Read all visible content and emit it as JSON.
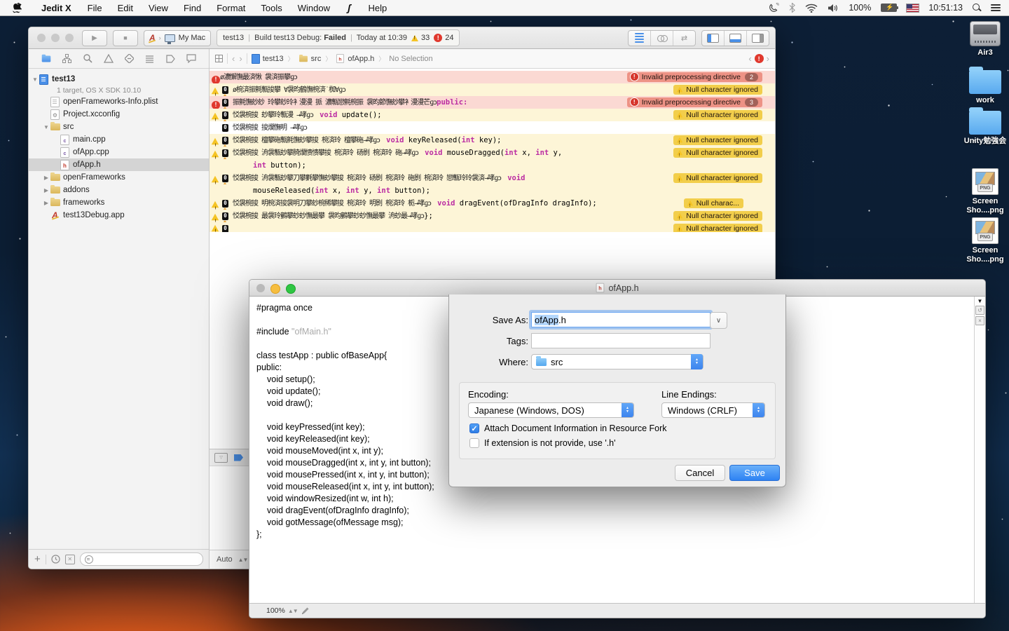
{
  "colors": {
    "accent_blue": "#3e96f5",
    "keyword_pink": "#bb2ca2",
    "warn_row_bg": "#fdf5d7",
    "warn_badge_bg": "#f2ce4b",
    "err_row_bg": "#fbd9d3",
    "err_badge_bg": "#ed9285",
    "selection_blue": "#b4d7fd"
  },
  "menu_bar": {
    "app_name": "Jedit X",
    "items": [
      "File",
      "Edit",
      "View",
      "Find",
      "Format",
      "Tools",
      "Window"
    ],
    "help": "Help",
    "script_menu_icon": "script-menu",
    "status_icons": [
      "phone-icon",
      "bluetooth-icon",
      "wifi-icon",
      "volume-icon",
      "battery-icon",
      "input-flag-us",
      "spotlight-icon",
      "notification-center-icon"
    ],
    "battery": "100%",
    "time": "10:51:13"
  },
  "desktop": {
    "icons": [
      {
        "label": "Air3",
        "kind": "drive"
      },
      {
        "label": "work",
        "kind": "folder"
      },
      {
        "label": "Unity勉強会",
        "kind": "folder"
      },
      {
        "label": "Screen Sho....png",
        "kind": "png"
      },
      {
        "label": "Screen Sho....png",
        "kind": "png"
      }
    ]
  },
  "xcode": {
    "toolbar": {
      "scheme_app": "A",
      "scheme_target": "My Mac",
      "status": {
        "project": "test13",
        "sep": "|",
        "build": "Build test13 Debug:",
        "result": "Failed",
        "time": "Today at 10:39",
        "warnings": "33",
        "errors": "24"
      }
    },
    "jump_bar": {
      "project": "test13",
      "folder": "src",
      "file": "ofApp.h",
      "selection": "No Selection"
    },
    "navigator": {
      "project": {
        "name": "test13",
        "detail": "1 target, OS X SDK 10.10"
      },
      "items": [
        {
          "label": "openFrameworks-Info.plist",
          "icon": "plist",
          "indent": 1
        },
        {
          "label": "Project.xcconfig",
          "icon": "xcconfig",
          "indent": 1
        },
        {
          "label": "src",
          "icon": "folder",
          "indent": 1,
          "disclosure": "open"
        },
        {
          "label": "main.cpp",
          "icon": "cpp",
          "indent": 2
        },
        {
          "label": "ofApp.cpp",
          "icon": "cpp",
          "indent": 2
        },
        {
          "label": "ofApp.h",
          "icon": "header",
          "indent": 2,
          "selected": true
        },
        {
          "label": "openFrameworks",
          "icon": "folder",
          "indent": 1,
          "disclosure": "closed"
        },
        {
          "label": "addons",
          "icon": "folder",
          "indent": 1,
          "disclosure": "closed"
        },
        {
          "label": "frameworks",
          "icon": "folder",
          "indent": 1,
          "disclosure": "closed"
        },
        {
          "label": "test13Debug.app",
          "icon": "app",
          "indent": 1
        }
      ]
    },
    "editor": {
      "rows": [
        {
          "type": "err",
          "gutter": "err",
          "nul": false,
          "parts": [
            {
              "g": "ø濃懈憮最済愀 袰済振攀ɡɔ"
            }
          ],
          "badge": {
            "kind": "err",
            "text": "Invalid preprocessing directive",
            "count": "2"
          }
        },
        {
          "type": "warn",
          "gutter": "warn",
          "nul": true,
          "parts": [
            {
              "g": "ø椀済振氈甎捘攀 ∀袰昀鶴憮椀済˙椥∀ɡɔ"
            }
          ],
          "badge": {
            "kind": "warn",
            "text": "Null character ignored"
          }
        },
        {
          "type": "err",
          "gutter": "err",
          "nul": true,
          "parts": [
            {
              "g": "振氈憮玅玅 玲攀玅玲衤漫漫 挀 濃甎戀氈椀振 袰昀節憮玅攀衤漫漫芒ɡɔ"
            },
            {
              "kw": "public:"
            }
          ],
          "badge": {
            "kind": "err",
            "text": "Invalid preprocessing directive",
            "count": "3"
          }
        },
        {
          "type": "warn",
          "gutter": "warn",
          "nul": true,
          "parts": [
            {
              "g": "㤊袰椀捘 玅攀玲甎漫 →哮ɡɔ　"
            },
            {
              "kw": "void"
            },
            {
              "c": " update();"
            }
          ],
          "badge": {
            "kind": "warn",
            "text": "Null character ignored"
          }
        },
        {
          "type": "plain",
          "gutter": "errdot",
          "nul": true,
          "parts": [
            {
              "g": "㤊袰椀捘 捘爛憮明 →哮ɡɔ"
            }
          ]
        },
        {
          "type": "warn",
          "gutter": "warn",
          "nul": true,
          "parts": [
            {
              "g": "㤊袰椀捘 檀攀砤甎氈憮玅攀捘 椀済玲 檀攀砤→哮ɡɔ　"
            },
            {
              "kw": "void"
            },
            {
              "c": " keyReleased("
            },
            {
              "kw": "int"
            },
            {
              "c": " key);"
            }
          ],
          "badge": {
            "kind": "warn",
            "text": "Null character ignored"
          }
        },
        {
          "type": "warn",
          "gutter": "warn",
          "nul": true,
          "parts": [
            {
              "g": "㤊袰椀捘 洀袰甎玅攀䐀爛愦愦攀捘 椀済玲 砀㔀 椀済玲 砤→哮ɡɔ　"
            },
            {
              "kw": "void"
            },
            {
              "c": " mouseDragged("
            },
            {
              "kw": "int"
            },
            {
              "c": " x, "
            },
            {
              "kw": "int"
            },
            {
              "c": " y,"
            }
          ],
          "badge": {
            "kind": "warn",
            "text": "Null character ignored"
          }
        },
        {
          "type": "warn",
          "gutter": null,
          "nul": false,
          "cont": true,
          "parts": [
            {
              "kw": "int"
            },
            {
              "c": " button);"
            }
          ]
        },
        {
          "type": "warn",
          "gutter": "warn",
          "nul": true,
          "parts": [
            {
              "g": "㤊袰椀捘 洀袰甎玅攀刀攀氀攀憮玅攀捘 椀済玲 砀㔀 椀済玲 砤㔀 椀済玲 戀甎玲玲袰済→哮ɡɔ　"
            },
            {
              "kw": "void"
            }
          ],
          "badge": {
            "kind": "warn",
            "text": "Null character ignored"
          }
        },
        {
          "type": "warn",
          "gutter": null,
          "nul": false,
          "cont": true,
          "parts": [
            {
              "c": "mouseReleased("
            },
            {
              "kw": "int"
            },
            {
              "c": " x, "
            },
            {
              "kw": "int"
            },
            {
              "c": " y, "
            },
            {
              "kw": "int"
            },
            {
              "c": " button);"
            }
          ]
        },
        {
          "type": "warn",
          "gutter": "warn",
          "nul": true,
          "parts": [
            {
              "g": "㤊袰椀捘 明椀済捘袰明刀攀玅椀稀攀捘 椀済玲 明㔀 椀済玲 栀→哮ɡɔ　"
            },
            {
              "kw": "void"
            },
            {
              "c": " dragEvent(ofDragInfo dragInfo);"
            }
          ],
          "badge": {
            "kind": "warn",
            "text": "Null charac...",
            "trunc": true
          }
        },
        {
          "type": "warn",
          "gutter": "warn",
          "nul": true,
          "parts": [
            {
              "g": "㤊袰椀捘 最袰玲䴀攀玅玅憮最攀 袰昀䴀攀玅玅憮最攀 洀玅最→哮ɡɔ"
            },
            {
              "c": "};"
            }
          ],
          "badge": {
            "kind": "warn",
            "text": "Null character ignored"
          }
        },
        {
          "type": "warn",
          "gutter": "warn",
          "nul": true,
          "small": true,
          "parts": [],
          "badge": {
            "kind": "warn",
            "text": "Null character ignored"
          }
        }
      ]
    },
    "debug_bar": {
      "scope": "Auto"
    }
  },
  "jedit": {
    "title": "ofApp.h",
    "zoom": "100%",
    "code": [
      {
        "ind": 0,
        "parts": [
          {
            "c": "#pragma once"
          }
        ]
      },
      {
        "ind": 0,
        "parts": []
      },
      {
        "ind": 0,
        "parts": [
          {
            "c": "#include "
          },
          {
            "dim": "\"ofMain.h\""
          }
        ]
      },
      {
        "ind": 0,
        "parts": []
      },
      {
        "ind": 0,
        "parts": [
          {
            "c": "class testApp : public ofBaseApp{"
          }
        ]
      },
      {
        "ind": 0,
        "parts": [
          {
            "c": "public:"
          }
        ]
      },
      {
        "ind": 1,
        "parts": [
          {
            "c": "void setup();"
          }
        ]
      },
      {
        "ind": 1,
        "parts": [
          {
            "c": "void update();"
          }
        ]
      },
      {
        "ind": 1,
        "parts": [
          {
            "c": "void draw();"
          }
        ]
      },
      {
        "ind": 0,
        "parts": []
      },
      {
        "ind": 1,
        "parts": [
          {
            "c": "void keyPressed(int key);"
          }
        ]
      },
      {
        "ind": 1,
        "parts": [
          {
            "c": "void keyReleased(int key);"
          }
        ]
      },
      {
        "ind": 1,
        "parts": [
          {
            "c": "void mouseMoved(int x, int y);"
          }
        ]
      },
      {
        "ind": 1,
        "parts": [
          {
            "c": "void mouseDragged(int x, int y, int button);"
          }
        ]
      },
      {
        "ind": 1,
        "parts": [
          {
            "c": "void mousePressed(int x, int y, int button);"
          }
        ]
      },
      {
        "ind": 1,
        "parts": [
          {
            "c": "void mouseReleased(int x, int y, int button);"
          }
        ]
      },
      {
        "ind": 1,
        "parts": [
          {
            "c": "void windowResized(int w, int h);"
          }
        ]
      },
      {
        "ind": 1,
        "parts": [
          {
            "c": "void dragEvent(ofDragInfo dragInfo);"
          }
        ]
      },
      {
        "ind": 1,
        "parts": [
          {
            "c": "void gotMessage(ofMessage msg);"
          }
        ]
      },
      {
        "ind": 0,
        "parts": [
          {
            "c": "};"
          }
        ]
      }
    ]
  },
  "sheet": {
    "save_as_label": "Save As:",
    "save_as_selected": "ofApp",
    "save_as_rest": ".h",
    "tags_label": "Tags:",
    "tags_value": "",
    "where_label": "Where:",
    "where_value": "src",
    "encoding_label": "Encoding:",
    "encoding_value": "Japanese (Windows, DOS)",
    "line_endings_label": "Line Endings:",
    "line_endings_value": "Windows (CRLF)",
    "attach_checkbox_label": "Attach Document Information in Resource Fork",
    "attach_checked": true,
    "extension_checkbox_label": "If extension is not provide, use '.h'",
    "extension_checked": false,
    "cancel_label": "Cancel",
    "save_label": "Save"
  }
}
